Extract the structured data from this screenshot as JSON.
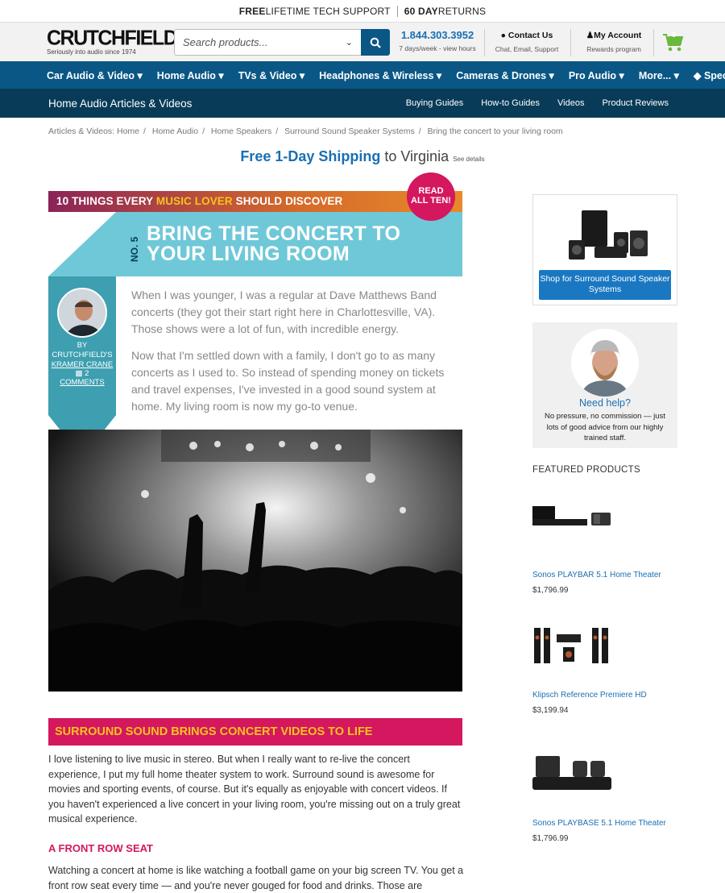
{
  "topbar": {
    "free_bold": "FREE",
    "free_rest": " LIFETIME TECH SUPPORT",
    "returns_bold": "60 DAY",
    "returns_rest": " RETURNS"
  },
  "logo": {
    "name": "CRUTCHFIELD",
    "tagline": "Seriously into audio since 1974"
  },
  "search": {
    "placeholder": "Search products..."
  },
  "phone": {
    "number": "1.844.303.3952",
    "hours": "7 days/week - view hours"
  },
  "contact": {
    "label": "Contact Us",
    "sub": "Chat, Email, Support"
  },
  "account": {
    "label": "My Account",
    "sub": "Rewards program"
  },
  "cart": {
    "count": "0"
  },
  "nav": [
    "Car Audio & Video ▾",
    "Home Audio ▾",
    "TVs & Video ▾",
    "Headphones & Wireless ▾",
    "Cameras & Drones ▾",
    "Pro Audio ▾",
    "More... ▾",
    "Specials ▾"
  ],
  "subnav": {
    "title": "Home Audio Articles & Videos",
    "links": [
      "Buying Guides",
      "How-to Guides",
      "Videos",
      "Product Reviews"
    ]
  },
  "breadcrumbs": [
    "Articles & Videos: Home",
    "Home Audio",
    "Home Speakers",
    "Surround Sound Speaker Systems",
    "Bring the concert to your living room"
  ],
  "shipping": {
    "bold": "Free 1-Day Shipping",
    "rest": " to Virginia ",
    "details": "See details"
  },
  "article": {
    "banner_a": "10 THINGS EVERY ",
    "banner_b": "MUSIC LOVER",
    "banner_c": " SHOULD DISCOVER",
    "read_all_1": "READ",
    "read_all_2": "ALL TEN!",
    "number": "NO. 5",
    "title_1": "BRING THE CONCERT TO",
    "title_2": "YOUR LIVING ROOM",
    "author_1": "BY CRUTCHFIELD'S",
    "author_2": "KRAMER CRANE",
    "comments_n": "2",
    "comments_label": "COMMENTS",
    "intro_1": "When I was younger, I was a regular at Dave Matthews Band concerts (they got their start right here in Charlottesville, VA). Those shows were a lot of fun, with incredible energy.",
    "intro_2": "Now that I'm settled down with a family, I don't go to as many concerts as I used to. So instead of spending money on tickets and travel expenses, I've invested in a good sound system at home. My living room is now my go-to venue.",
    "section_heading": "SURROUND SOUND BRINGS CONCERT VIDEOS TO LIFE",
    "body_1": "I love listening to live music in stereo. But when I really want to re-live the concert experience, I put my full home theater system to work. Surround sound is awesome for movies and sporting events, of course. But it's equally as enjoyable with concert videos. If you haven't experienced a live concert in your living room, you're missing out on a truly great musical experience.",
    "subheading": "A FRONT ROW SEAT",
    "body_2": "Watching a concert at home is like watching a football game on your big screen TV. You get a front row seat every time — and you're never gouged for food and drinks. Those are"
  },
  "sidebar": {
    "shop_button": "Shop for Surround Sound Speaker Systems",
    "help_title": "Need help?",
    "help_desc": "No pressure, no commission — just lots of good advice from our highly trained staff.",
    "featured_heading": "FEATURED PRODUCTS",
    "products": [
      {
        "name": "Sonos PLAYBAR 5.1 Home Theater",
        "price": "$1,796.99"
      },
      {
        "name": "Klipsch Reference Premiere HD",
        "price": "$3,199.94"
      },
      {
        "name": "Sonos PLAYBASE 5.1 Home Theater",
        "price": "$1,796.99"
      }
    ]
  },
  "colors": {
    "nav_blue": "#0a5785",
    "subnav_navy": "#083b58",
    "link_blue": "#1a6fb3",
    "magenta": "#d4175f",
    "teal": "#6fc8d8",
    "yellow": "#f6c31e"
  }
}
